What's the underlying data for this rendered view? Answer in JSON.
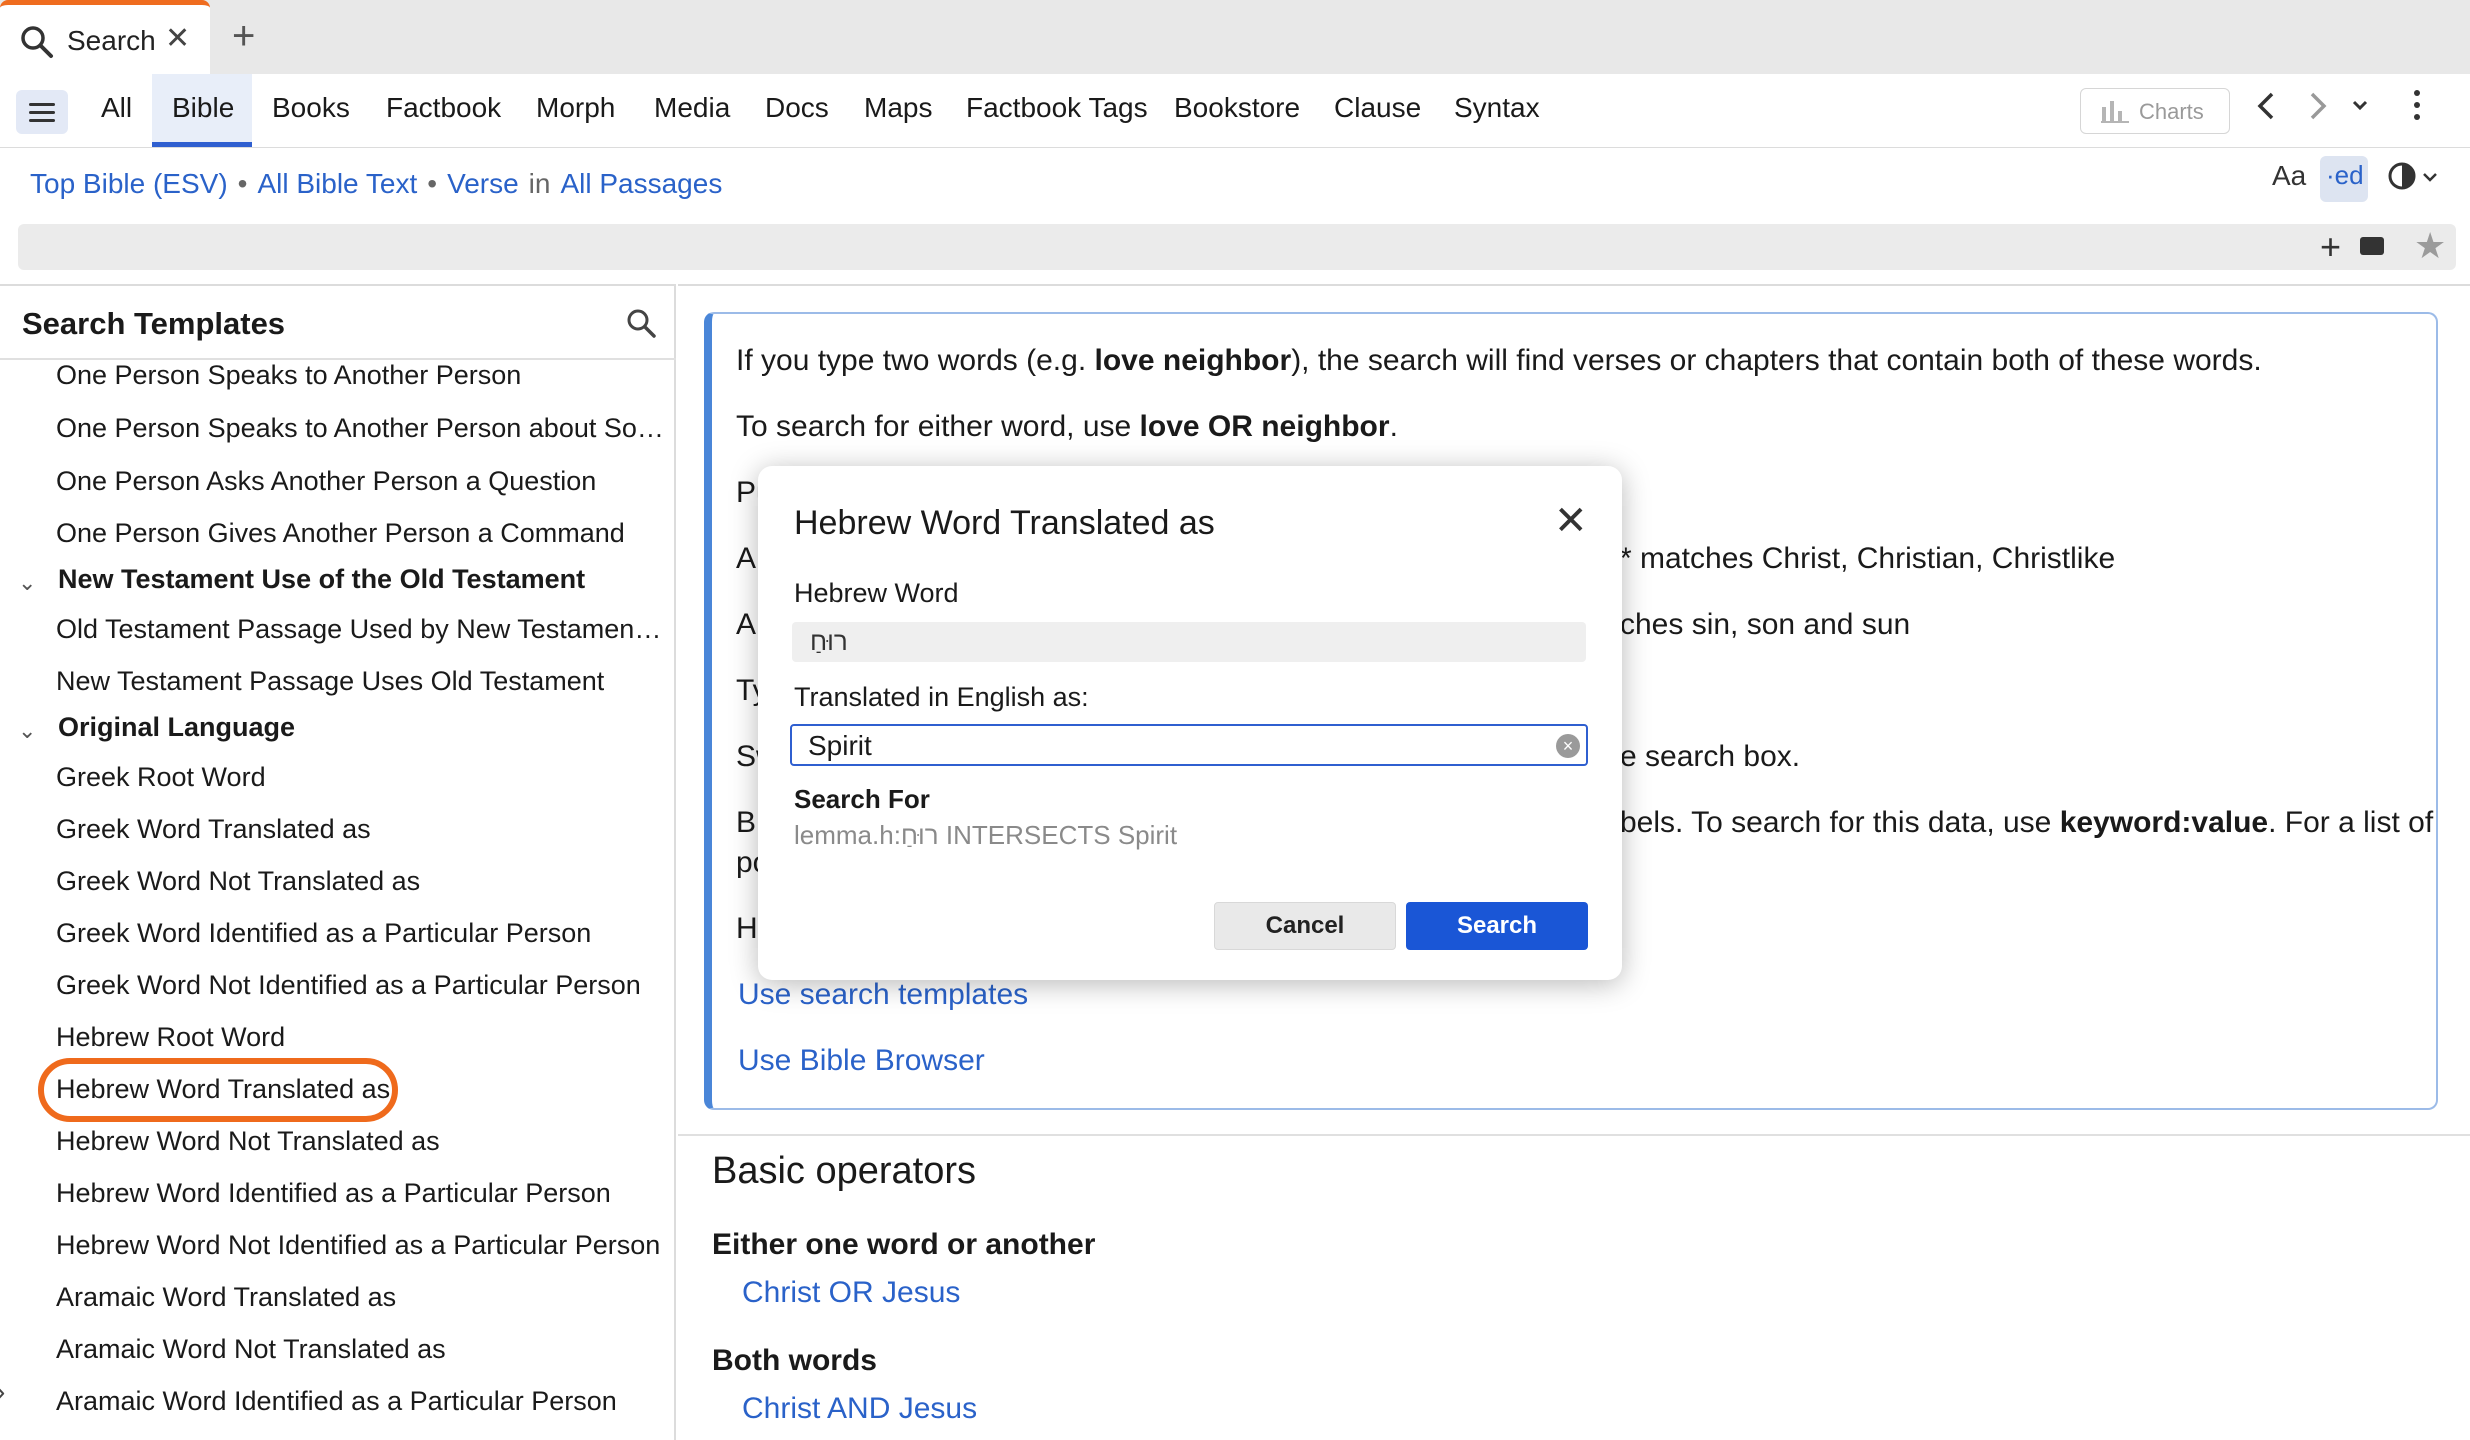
{
  "tab": {
    "label": "Search",
    "close": "✕",
    "new": "+"
  },
  "nav": {
    "items": [
      "All",
      "Bible",
      "Books",
      "Factbook",
      "Morph",
      "Media",
      "Docs",
      "Maps",
      "Factbook Tags",
      "Bookstore",
      "Clause",
      "Syntax"
    ],
    "charts": "Charts"
  },
  "crumbs": {
    "bible": "Top Bible (ESV)",
    "scope": "All Bible Text",
    "unit": "Verse",
    "in": "in",
    "range": "All Passages"
  },
  "toolbar": {
    "aa": "Aa",
    "ed": "·ed"
  },
  "left": {
    "title": "Search Templates",
    "items": {
      "t1": "One Person Speaks to Another Person",
      "t2": "One Person Speaks to Another Person about Som…",
      "t3": "One Person Asks Another Person a Question",
      "t4": "One Person Gives Another Person a Command",
      "g1": "New Testament Use of the Old Testament",
      "t5": "Old Testament Passage Used by New Testament A…",
      "t6": "New Testament Passage Uses Old Testament",
      "g2": "Original Language",
      "t7": "Greek Root Word",
      "t8": "Greek Word Translated as",
      "t9": "Greek Word Not Translated as",
      "t10": "Greek Word Identified as a Particular Person",
      "t11": "Greek Word Not Identified as a Particular Person",
      "t12": "Hebrew Root Word",
      "t13": "Hebrew Word Translated as",
      "t14": "Hebrew Word Not Translated as",
      "t15": "Hebrew Word Identified as a Particular Person",
      "t16": "Hebrew Word Not Identified as a Particular Person",
      "t17": "Aramaic Word Translated as",
      "t18": "Aramaic Word Not Translated as",
      "t19": "Aramaic Word Identified as a Particular Person"
    }
  },
  "help": {
    "l1a": "If you type two words (e.g. ",
    "l1b": "love neighbor",
    "l1c": "), the search will find verses or chapters that contain both of these words.",
    "l2a": "To search for either word, use ",
    "l2b": "love OR neighbor",
    "l2c": ".",
    "l3": "Pu",
    "l4a": "An",
    "l4b": "* matches Christ, Christian, Christlike",
    "l5a": "A",
    "l5b": "ches sin, son and sun",
    "l6": "Ty",
    "l7a": "Sw",
    "l7b": "e search box.",
    "l8a": "Bi",
    "l8b": "bels. To search for this data, use ",
    "l8c": "keyword:value",
    "l8d": ". For a list of",
    "l9": "po",
    "l10": "H",
    "link1": "Use search templates",
    "link2": "Use Bible Browser",
    "basic": "Basic operators",
    "either": "Either one word or another",
    "either_ex": "Christ OR Jesus",
    "both": "Both words",
    "both_ex": "Christ AND Jesus"
  },
  "modal": {
    "title": "Hebrew Word Translated as",
    "close": "✕",
    "hebrew_label": "Hebrew Word",
    "hebrew_value": "רוּחַ",
    "english_label": "Translated in English as:",
    "english_value": "Spirit",
    "search_for_label": "Search For",
    "query": "lemma.h:רוּחַ INTERSECTS Spirit",
    "cancel": "Cancel",
    "search": "Search"
  }
}
